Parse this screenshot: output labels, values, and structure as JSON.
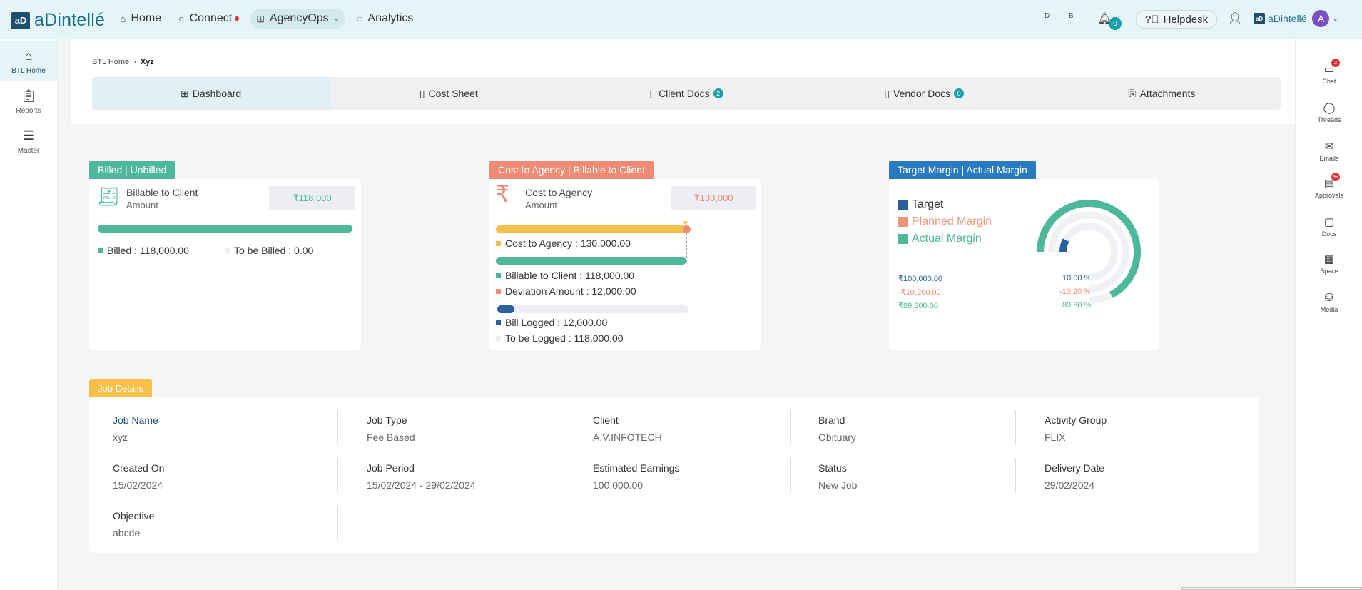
{
  "app": {
    "logo_mark": "aD",
    "logo_text": "aDintellé"
  },
  "nav": {
    "home": "Home",
    "connect": "Connect",
    "agencyops": "AgencyOps",
    "analytics": "Analytics"
  },
  "top_right": {
    "letter_d": "D",
    "letter_b": "B",
    "notif_count": "0",
    "helpdesk": "Helpdesk",
    "brand_text": "aDintellé",
    "avatar_letter": "A"
  },
  "left_sidebar": [
    {
      "label": "BTL Home",
      "icon": "home-icon"
    },
    {
      "label": "Reports",
      "icon": "clipboard-icon"
    },
    {
      "label": "Master",
      "icon": "list-icon"
    }
  ],
  "right_sidebar": [
    {
      "label": "Chat",
      "badge": "2",
      "icon": "chat-icon"
    },
    {
      "label": "Threads",
      "badge": "",
      "icon": "threads-icon"
    },
    {
      "label": "Emails",
      "badge": "",
      "icon": "mail-icon"
    },
    {
      "label": "Approvals",
      "badge": "9+",
      "icon": "approvals-icon"
    },
    {
      "label": "Docs",
      "badge": "",
      "icon": "folder-icon"
    },
    {
      "label": "Space",
      "badge": "",
      "icon": "space-icon"
    },
    {
      "label": "Media",
      "badge": "",
      "icon": "database-icon"
    }
  ],
  "breadcrumb": {
    "root": "BTL Home",
    "current": "Xyz"
  },
  "tabs": [
    {
      "label": "Dashboard",
      "badge": ""
    },
    {
      "label": "Cost Sheet",
      "badge": ""
    },
    {
      "label": "Client Docs",
      "badge": "2"
    },
    {
      "label": "Vendor Docs",
      "badge": "0"
    },
    {
      "label": "Attachments",
      "badge": ""
    }
  ],
  "billed_card": {
    "label": "Billed | Unbilled",
    "title": "Billable to Client",
    "subtitle": "Amount",
    "amount": "₹118,000",
    "billed_fraction": 1.0,
    "billed_legend": "Billed : 118,000.00",
    "to_be_billed_legend": "To be Billed : 0.00"
  },
  "cost_card": {
    "label": "Cost to Agency | Billable to Client",
    "rupee_symbol": "₹",
    "title": "Cost to Agency",
    "subtitle": "Amount",
    "amount": "₹130,000",
    "cost_to_agency": "Cost to Agency : 130,000.00",
    "billable": "Billable to Client : 118,000.00",
    "deviation": "Deviation Amount : 12,000.00",
    "bill_logged": "Bill Logged : 12,000.00",
    "to_be_logged": "To be Logged : 118,000.00",
    "bill_logged_fraction": 0.09
  },
  "margin_card": {
    "label": "Target Margin | Actual Margin",
    "legend": [
      {
        "name": "Target",
        "color": "#2a5fa0"
      },
      {
        "name": "Planned Margin",
        "color": "#ef9676"
      },
      {
        "name": "Actual Margin",
        "color": "#4db89b"
      }
    ],
    "rows": [
      {
        "amount": "₹100,000.00",
        "pct": "10.00 %"
      },
      {
        "amount": "-₹10,200.00",
        "pct": "-10.20 %"
      },
      {
        "amount": "₹89,800.00",
        "pct": "89.80 %"
      }
    ],
    "target_pct": 10.0,
    "planned_pct": -10.2,
    "actual_pct": 89.8
  },
  "job_details": {
    "label": "Job Details",
    "fields": [
      {
        "label": "Job Name",
        "value": "xyz"
      },
      {
        "label": "Job Type",
        "value": "Fee Based"
      },
      {
        "label": "Client",
        "value": "A.V.INFOTECH"
      },
      {
        "label": "Brand",
        "value": "Obituary"
      },
      {
        "label": "Activity Group",
        "value": "FLIX"
      },
      {
        "label": "Created On",
        "value": "15/02/2024"
      },
      {
        "label": "Job Period",
        "value": "15/02/2024 - 29/02/2024"
      },
      {
        "label": "Estimated Earnings",
        "value": "100,000.00"
      },
      {
        "label": "Status",
        "value": "New Job"
      },
      {
        "label": "Delivery Date",
        "value": "29/02/2024"
      },
      {
        "label": "Objective",
        "value": "abcde"
      }
    ]
  },
  "colors": {
    "teal": "#4db89b",
    "salmon": "#ef8a74",
    "blue": "#2a7ac0",
    "yellow": "#f7c04a"
  }
}
